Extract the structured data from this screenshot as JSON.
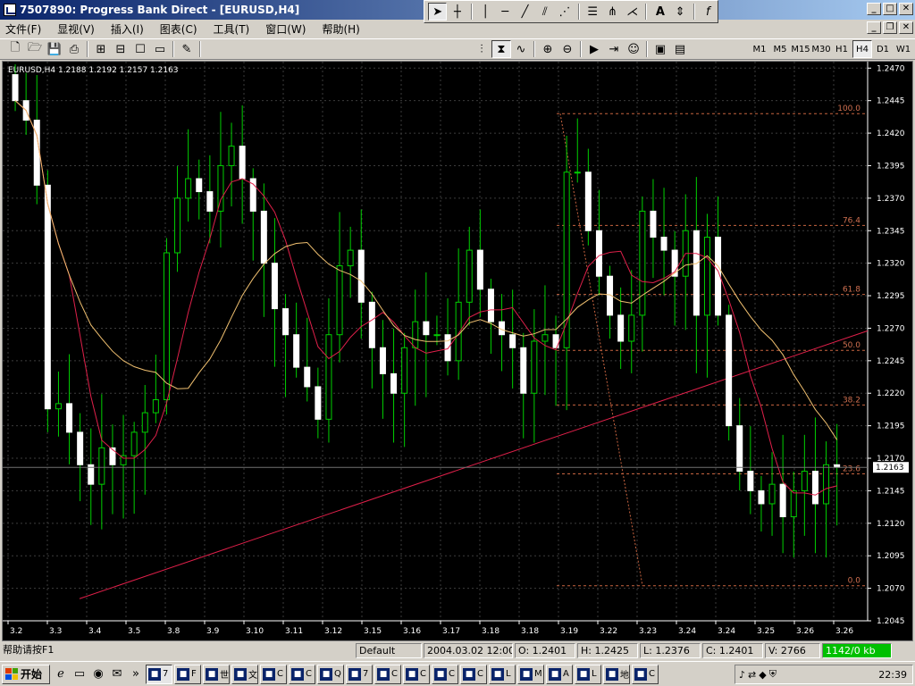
{
  "window": {
    "title": "7507890: Progress Bank Direct - [EURUSD,H4]"
  },
  "drawing_toolbar": {
    "icons": [
      "cursor",
      "crosshair",
      "vertical-line",
      "horizontal-line",
      "trend-line",
      "channel",
      "gann-fan",
      "fibo-lines",
      "pitchfork",
      "fibo-fan",
      "text",
      "arrows",
      "function"
    ],
    "text_tool": "A",
    "function_tool": "f"
  },
  "menu": {
    "items": [
      "文件(F)",
      "显视(V)",
      "插入(I)",
      "图表(C)",
      "工具(T)",
      "窗口(W)",
      "帮助(H)"
    ]
  },
  "timeframes": [
    "M1",
    "M5",
    "M15",
    "M30",
    "H1",
    "H4",
    "D1",
    "W1"
  ],
  "active_timeframe": "H4",
  "chart": {
    "header": "EURUSD,H4  1.2188 1.2192 1.2157 1.2163",
    "current_price": "1.2163"
  },
  "chart_data": {
    "type": "candlestick",
    "symbol": "EURUSD",
    "timeframe": "H4",
    "ohlc_last": {
      "open": 1.2188,
      "high": 1.2192,
      "low": 1.2157,
      "close": 1.2163
    },
    "ylim": [
      1.2045,
      1.2475
    ],
    "y_ticks": [
      "1.2470",
      "1.2445",
      "1.2420",
      "1.2395",
      "1.2370",
      "1.2345",
      "1.2320",
      "1.2295",
      "1.2270",
      "1.2245",
      "1.2220",
      "1.2195",
      "1.2170",
      "1.2145",
      "1.2120",
      "1.2095",
      "1.2070",
      "1.2045"
    ],
    "x_ticks": [
      "3.2",
      "3.3",
      "3.4",
      "3.5",
      "3.8",
      "3.9",
      "3.10",
      "3.11",
      "3.12",
      "3.15",
      "3.16",
      "3.17",
      "3.18",
      "3.18",
      "3.19",
      "3.22",
      "3.23",
      "3.24",
      "3.24",
      "3.25",
      "3.26",
      "3.26"
    ],
    "fibonacci": {
      "high": 1.2435,
      "low": 1.2072,
      "levels": [
        {
          "label": "100.0",
          "value": 1.2435
        },
        {
          "label": "76.4",
          "value": 1.2349
        },
        {
          "label": "61.8",
          "value": 1.2296
        },
        {
          "label": "50.0",
          "value": 1.2253
        },
        {
          "label": "38.2",
          "value": 1.2211
        },
        {
          "label": "23.6",
          "value": 1.2158
        },
        {
          "label": "0.0",
          "value": 1.2072
        }
      ]
    },
    "closes": [
      1.2445,
      1.243,
      1.238,
      1.2208,
      1.2212,
      1.219,
      1.2165,
      1.215,
      1.2178,
      1.2165,
      1.2172,
      1.219,
      1.2205,
      1.2215,
      1.2328,
      1.237,
      1.2385,
      1.2375,
      1.236,
      1.2395,
      1.241,
      1.2385,
      1.236,
      1.232,
      1.2285,
      1.2265,
      1.224,
      1.2225,
      1.22,
      1.2265,
      1.2318,
      1.233,
      1.229,
      1.2255,
      1.2235,
      1.222,
      1.2255,
      1.2275,
      1.2265,
      1.2265,
      1.2245,
      1.229,
      1.233,
      1.23,
      1.2275,
      1.2265,
      1.2255,
      1.222,
      1.226,
      1.2265,
      1.2255,
      1.239,
      1.239,
      1.2345,
      1.231,
      1.228,
      1.226,
      1.228,
      1.236,
      1.234,
      1.233,
      1.231,
      1.2345,
      1.228,
      1.234,
      1.228,
      1.2195,
      1.216,
      1.2145,
      1.2135,
      1.215,
      1.2125,
      1.2145,
      1.216,
      1.2135,
      1.2165,
      1.2163
    ]
  },
  "status": {
    "help": "帮助请按F1",
    "profile": "Default",
    "datetime": "2004.03.02 12:00",
    "open": "O: 1.2401",
    "high": "H: 1.2425",
    "low": "L: 1.2376",
    "close": "C: 1.2401",
    "volume": "V: 2766",
    "traffic": "1142/0 kb"
  },
  "taskbar": {
    "start": "开始",
    "tasks": [
      "7",
      "F",
      "世",
      "文",
      "C",
      "C",
      "Q",
      "7",
      "C",
      "C",
      "C",
      "C",
      "L",
      "M",
      "A",
      "L",
      "地",
      "C"
    ],
    "clock": "22:39"
  }
}
